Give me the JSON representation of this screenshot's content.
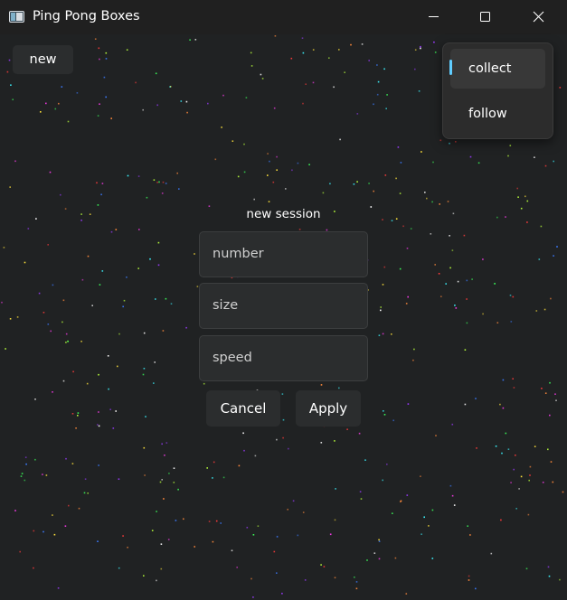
{
  "titlebar": {
    "title": "Ping Pong Boxes"
  },
  "toolbar": {
    "new_label": "new"
  },
  "menu": {
    "items": [
      {
        "label": "collect",
        "selected": true
      },
      {
        "label": "follow",
        "selected": false
      }
    ]
  },
  "session_form": {
    "heading": "new session",
    "fields": {
      "number": {
        "placeholder": "number"
      },
      "size": {
        "placeholder": "size"
      },
      "speed": {
        "placeholder": "speed"
      }
    },
    "cancel_label": "Cancel",
    "apply_label": "Apply"
  },
  "icons": {
    "app": "app-window-icon",
    "minimize": "minimize-icon",
    "maximize": "maximize-icon",
    "close": "close-icon"
  },
  "colors": {
    "background": "#202223",
    "titlebar": "#202020",
    "surface": "#2b2d2e",
    "accent": "#60cdff",
    "text": "#ffffff"
  }
}
